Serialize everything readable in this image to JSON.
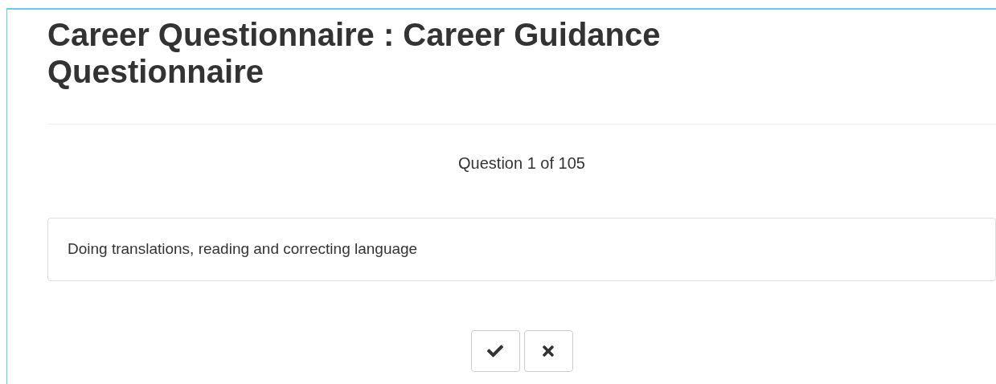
{
  "title": "Career Questionnaire : Career Guidance Questionnaire",
  "progress": "Question 1 of 105",
  "question": "Doing translations, reading and correcting language",
  "buttons": [
    {
      "kind": "yes"
    },
    {
      "kind": "no"
    }
  ]
}
